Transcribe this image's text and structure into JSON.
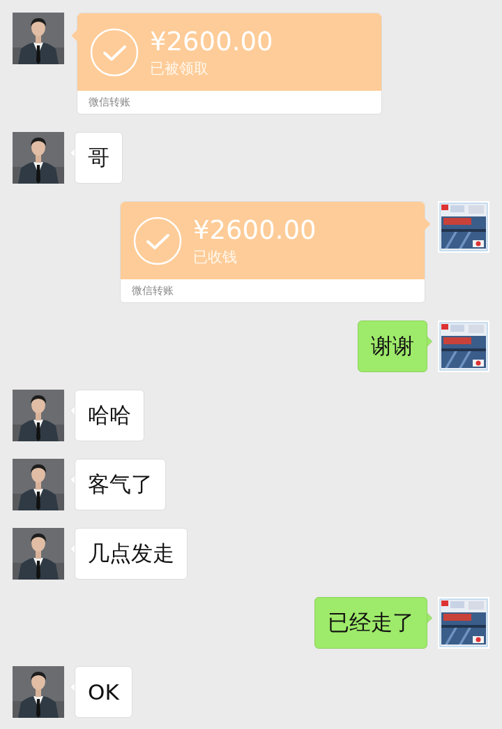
{
  "messages": [
    {
      "outgoing": false,
      "kind": "transfer",
      "amount": "¥2600.00",
      "status": "已被领取",
      "label": "微信转账"
    },
    {
      "outgoing": false,
      "kind": "text",
      "text": "哥"
    },
    {
      "outgoing": true,
      "kind": "transfer",
      "amount": "¥2600.00",
      "status": "已收钱",
      "label": "微信转账"
    },
    {
      "outgoing": true,
      "kind": "text",
      "text": "谢谢"
    },
    {
      "outgoing": false,
      "kind": "text",
      "text": "哈哈"
    },
    {
      "outgoing": false,
      "kind": "text",
      "text": "客气了"
    },
    {
      "outgoing": false,
      "kind": "text",
      "text": "几点发走"
    },
    {
      "outgoing": true,
      "kind": "text",
      "text": "已经走了"
    },
    {
      "outgoing": false,
      "kind": "text",
      "text": "OK"
    }
  ]
}
